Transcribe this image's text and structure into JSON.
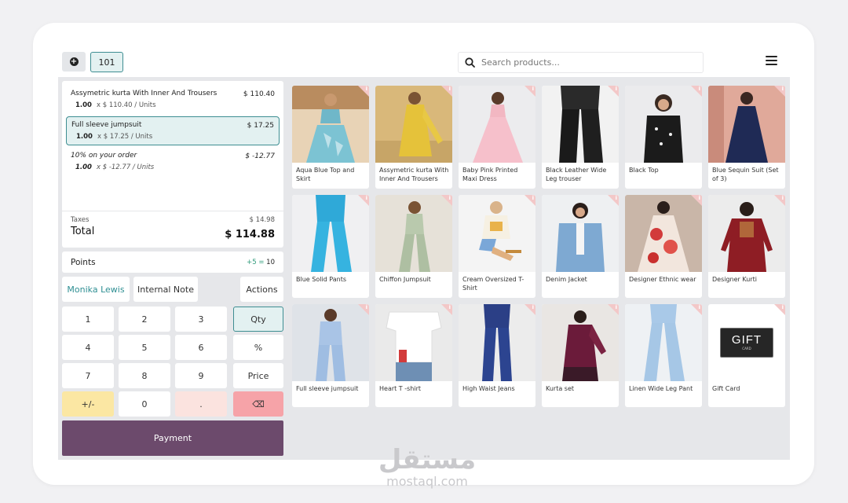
{
  "header": {
    "order_number": "101",
    "search_placeholder": "Search products..."
  },
  "orderlines": [
    {
      "name": "Assymetric kurta With Inner And Trousers",
      "price": "$ 110.40",
      "qty": "1.00",
      "unit_text": "x $ 110.40 / Units"
    },
    {
      "name": "Full sleeve jumpsuit",
      "price": "$ 17.25",
      "qty": "1.00",
      "unit_text": "x $ 17.25 / Units"
    },
    {
      "name": "10% on your order",
      "price": "$ -12.77",
      "qty": "1.00",
      "unit_text": "x $ -12.77 / Units"
    }
  ],
  "totals": {
    "tax_label": "Taxes",
    "tax_value": "$ 14.98",
    "total_label": "Total",
    "total_value": "$ 114.88"
  },
  "points": {
    "label": "Points",
    "gain": "+5 =",
    "total": "10"
  },
  "controls": {
    "customer": "Monika Lewis",
    "note": "Internal Note",
    "actions": "Actions"
  },
  "numpad": {
    "keys": [
      "1",
      "2",
      "3",
      "Qty",
      "4",
      "5",
      "6",
      "%",
      "7",
      "8",
      "9",
      "Price",
      "+/-",
      "0",
      ".",
      "⌫"
    ],
    "backspace_icon": "backspace-icon"
  },
  "payment_label": "Payment",
  "products": [
    {
      "name": "Aqua Blue Top and Skirt",
      "img": "aqua"
    },
    {
      "name": "Assymetric kurta With Inner And Trousers",
      "img": "yellow"
    },
    {
      "name": "Baby Pink Printed Maxi Dress",
      "img": "pink"
    },
    {
      "name": "Black Leather Wide Leg trouser",
      "img": "black"
    },
    {
      "name": "Black Top",
      "img": "blacktop"
    },
    {
      "name": "Blue Sequin Suit (Set of 3)",
      "img": "navy"
    },
    {
      "name": "Blue Solid Pants",
      "img": "bluepants"
    },
    {
      "name": "Chiffon Jumpsuit",
      "img": "sage"
    },
    {
      "name": "Cream Oversized T-Shirt",
      "img": "cream"
    },
    {
      "name": "Denim Jacket",
      "img": "denim"
    },
    {
      "name": "Designer Ethnic wear",
      "img": "ethnic"
    },
    {
      "name": "Designer Kurti",
      "img": "maroon"
    },
    {
      "name": "Full sleeve jumpsuit",
      "img": "lightblue"
    },
    {
      "name": "Heart T -shirt",
      "img": "white"
    },
    {
      "name": "High Waist Jeans",
      "img": "jeans"
    },
    {
      "name": "Kurta set",
      "img": "kurtaset"
    },
    {
      "name": "Linen Wide Leg Pant",
      "img": "linen"
    },
    {
      "name": "Gift Card",
      "img": "gift"
    }
  ],
  "gift_card": {
    "line1": "GIFT",
    "line2": "CARD"
  },
  "watermark": {
    "arabic": "مستقل",
    "latin": "mostaql.com"
  },
  "colors": {
    "accent": "#3e8e92",
    "payment": "#6c4a6c",
    "backspace": "#f6a3a8",
    "plusminus": "#fbe7a3"
  }
}
